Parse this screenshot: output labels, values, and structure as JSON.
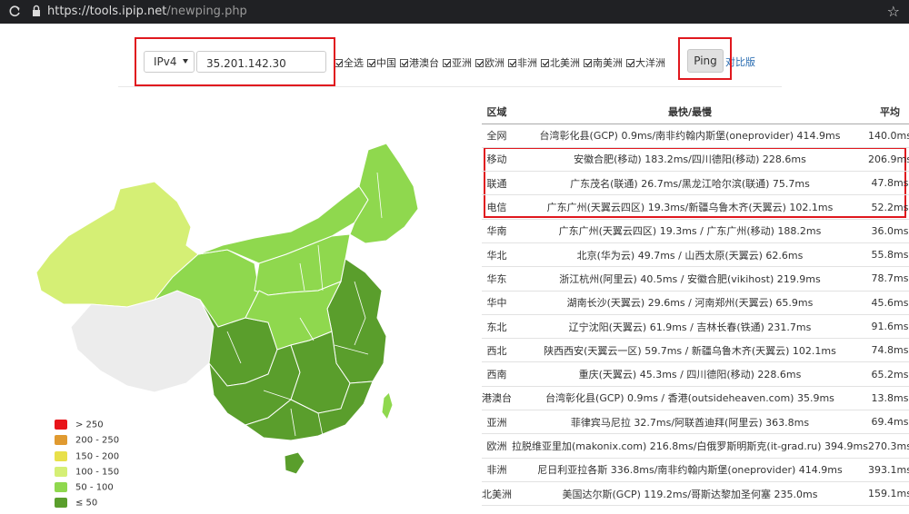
{
  "browser": {
    "url_host": "https://tools.ipip.net",
    "url_path": "/newping.php"
  },
  "controls": {
    "ip_version": "IPv4",
    "ip_value": "35.201.142.30",
    "checkboxes": [
      {
        "label": "全选",
        "checked": true
      },
      {
        "label": "中国",
        "checked": true
      },
      {
        "label": "港澳台",
        "checked": true
      },
      {
        "label": "亚洲",
        "checked": true
      },
      {
        "label": "欧洲",
        "checked": true
      },
      {
        "label": "非洲",
        "checked": true
      },
      {
        "label": "北美洲",
        "checked": true
      },
      {
        "label": "南美洲",
        "checked": true
      },
      {
        "label": "大洋洲",
        "checked": true
      }
    ],
    "ping_label": "Ping",
    "compare_label": "对比版"
  },
  "legend": [
    {
      "label": "> 250",
      "color": "#e8141a"
    },
    {
      "label": "200 - 250",
      "color": "#e09a30"
    },
    {
      "label": "150 - 200",
      "color": "#e8e04a"
    },
    {
      "label": "100 - 150",
      "color": "#d5ef75"
    },
    {
      "label": "50 - 100",
      "color": "#8fd84e"
    },
    {
      "label": "≤ 50",
      "color": "#5a9e2c"
    }
  ],
  "table": {
    "headers": [
      "区域",
      "最快/最慢",
      "平均"
    ],
    "rows": [
      {
        "region": "全网",
        "range": "台湾彰化县(GCP) 0.9ms/南非约翰内斯堡(oneprovider) 414.9ms",
        "avg": "140.0ms"
      },
      {
        "region": "移动",
        "range": "安徽合肥(移动) 183.2ms/四川德阳(移动) 228.6ms",
        "avg": "206.9ms"
      },
      {
        "region": "联通",
        "range": "广东茂名(联通) 26.7ms/黑龙江哈尔滨(联通) 75.7ms",
        "avg": "47.8ms"
      },
      {
        "region": "电信",
        "range": "广东广州(天翼云四区) 19.3ms/新疆乌鲁木齐(天翼云) 102.1ms",
        "avg": "52.2ms"
      },
      {
        "region": "华南",
        "range": "广东广州(天翼云四区) 19.3ms / 广东广州(移动) 188.2ms",
        "avg": "36.0ms"
      },
      {
        "region": "华北",
        "range": "北京(华为云) 49.7ms / 山西太原(天翼云) 62.6ms",
        "avg": "55.8ms"
      },
      {
        "region": "华东",
        "range": "浙江杭州(阿里云) 40.5ms / 安徽合肥(vikihost) 219.9ms",
        "avg": "78.7ms"
      },
      {
        "region": "华中",
        "range": "湖南长沙(天翼云) 29.6ms / 河南郑州(天翼云) 65.9ms",
        "avg": "45.6ms"
      },
      {
        "region": "东北",
        "range": "辽宁沈阳(天翼云) 61.9ms / 吉林长春(铁通) 231.7ms",
        "avg": "91.6ms"
      },
      {
        "region": "西北",
        "range": "陕西西安(天翼云一区) 59.7ms / 新疆乌鲁木齐(天翼云) 102.1ms",
        "avg": "74.8ms"
      },
      {
        "region": "西南",
        "range": "重庆(天翼云) 45.3ms / 四川德阳(移动) 228.6ms",
        "avg": "65.2ms"
      },
      {
        "region": "港澳台",
        "range": "台湾彰化县(GCP) 0.9ms / 香港(outsideheaven.com) 35.9ms",
        "avg": "13.8ms"
      },
      {
        "region": "亚洲",
        "range": "菲律宾马尼拉 32.7ms/阿联酋迪拜(阿里云) 363.8ms",
        "avg": "69.4ms"
      },
      {
        "region": "欧洲",
        "range": "拉脱维亚里加(makonix.com) 216.8ms/白俄罗斯明斯克(it-grad.ru) 394.9ms",
        "avg": "270.3ms"
      },
      {
        "region": "非洲",
        "range": "尼日利亚拉各斯 336.8ms/南非约翰内斯堡(oneprovider) 414.9ms",
        "avg": "393.1ms"
      },
      {
        "region": "北美洲",
        "range": "美国达尔斯(GCP) 119.2ms/哥斯达黎加圣何塞 235.0ms",
        "avg": "159.1ms"
      }
    ]
  },
  "colors": {
    "highlight_border": "#e0181e",
    "link": "#2a6db2"
  }
}
